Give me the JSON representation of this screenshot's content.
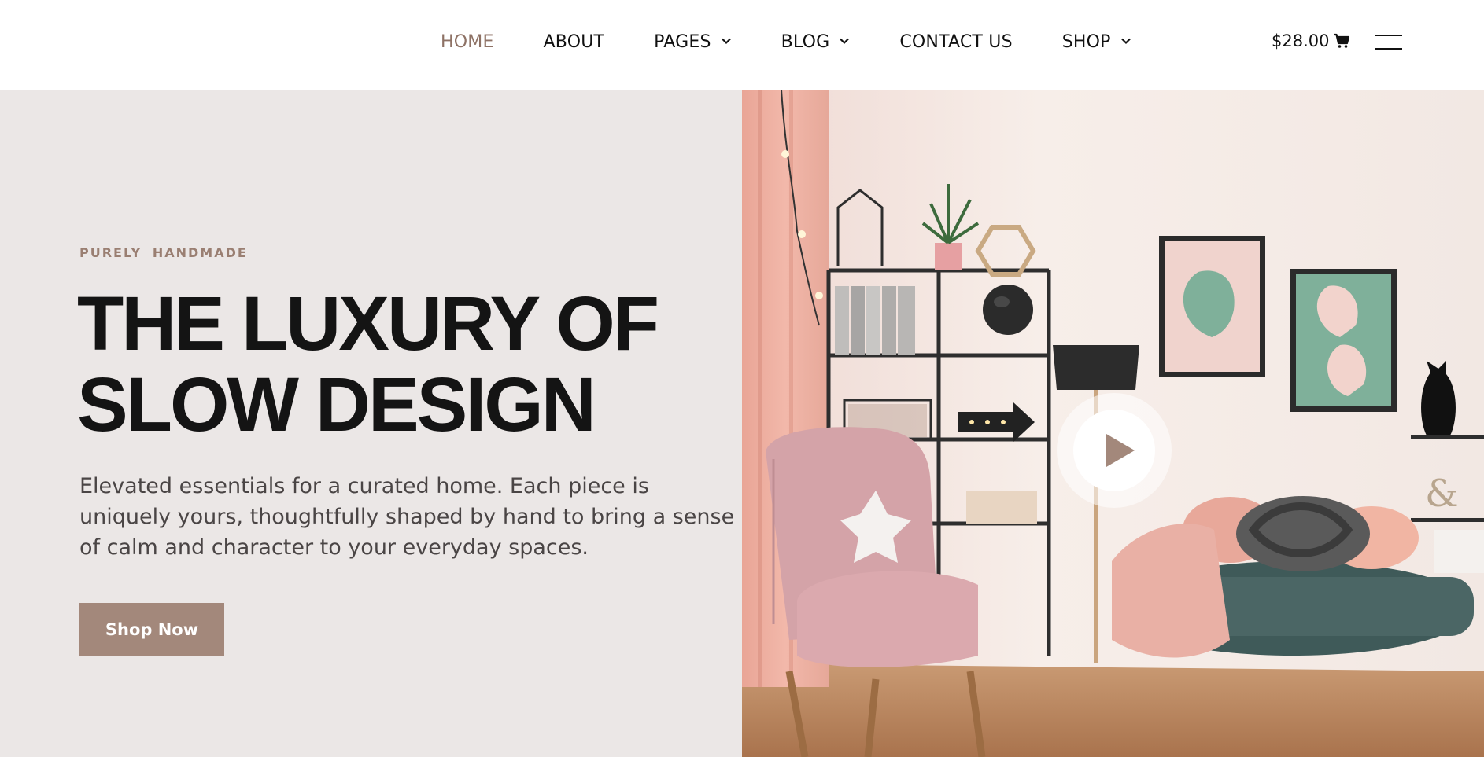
{
  "nav": {
    "items": [
      {
        "label": "HOME",
        "active": true
      },
      {
        "label": "ABOUT"
      },
      {
        "label": "PAGES",
        "dropdown": true
      },
      {
        "label": "BLOG",
        "dropdown": true
      },
      {
        "label": "CONTACT US"
      },
      {
        "label": "SHOP",
        "dropdown": true
      }
    ],
    "cart_total": "$28.00",
    "cart_icon": "shopping-cart-icon",
    "menu_icon": "hamburger-menu-icon"
  },
  "hero": {
    "eyebrow": "PURELY  HANDMADE",
    "headline_lines": [
      "THE LUXURY OF",
      "SLOW DESIGN"
    ],
    "description_lines": [
      "Elevated essentials for a curated home. Each piece is",
      "uniquely yours, thoughtfully shaped by hand to bring a sense",
      "of calm and character to your everyday spaces."
    ],
    "cta_label": "Shop Now",
    "play_icon": "play-icon"
  },
  "colors": {
    "accent": "#a3887b",
    "active_nav": "#8e7265",
    "hero_bg": "#ebe7e6",
    "text": "#141414"
  }
}
